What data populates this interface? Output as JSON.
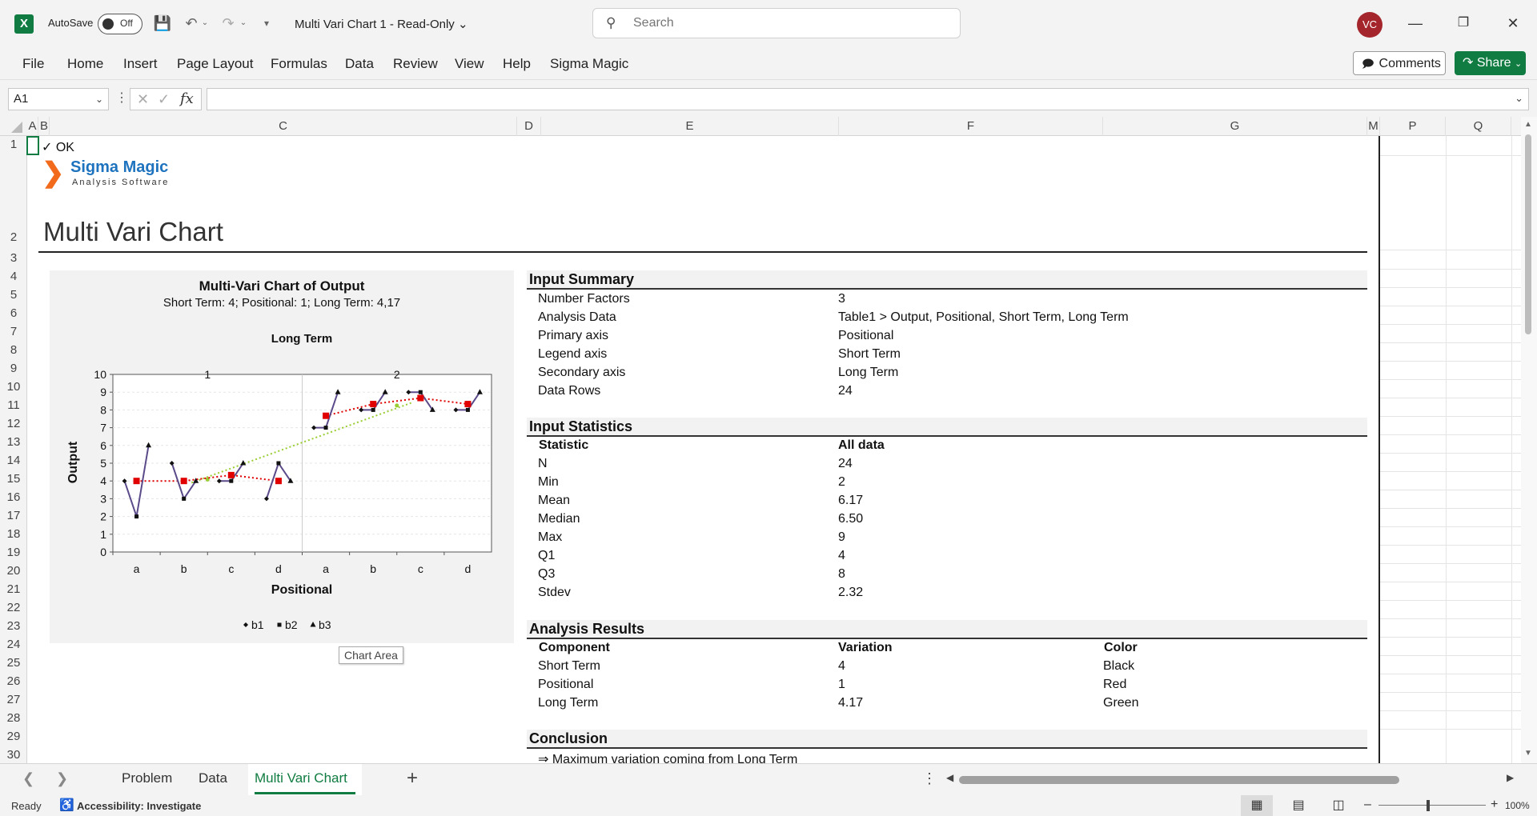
{
  "titlebar": {
    "app_icon": "X",
    "autosave_label": "AutoSave",
    "autosave_state": "Off",
    "doc_title": "Multi Vari Chart 1  -  Read-Only",
    "search_placeholder": "Search",
    "avatar_initials": "VC"
  },
  "ribbon": {
    "tabs": [
      "File",
      "Home",
      "Insert",
      "Page Layout",
      "Formulas",
      "Data",
      "Review",
      "View",
      "Help",
      "Sigma Magic"
    ],
    "comments_label": "Comments",
    "share_label": "Share"
  },
  "formula_bar": {
    "name_box": "A1",
    "formula": ""
  },
  "columns": [
    "A",
    "B",
    "C",
    "D",
    "E",
    "F",
    "G",
    "M",
    "P",
    "Q"
  ],
  "rows": [
    "1",
    "2",
    "3",
    "4",
    "5",
    "6",
    "7",
    "8",
    "9",
    "10",
    "11",
    "12",
    "13",
    "14",
    "15",
    "16",
    "17",
    "18",
    "19",
    "20",
    "21",
    "22",
    "23",
    "24",
    "25",
    "26",
    "27",
    "28",
    "29",
    "30"
  ],
  "sheet": {
    "ok_text": "✓ OK",
    "logo_name": "Sigma Magic",
    "logo_sub": "Analysis Software",
    "page_title": "Multi Vari Chart",
    "chart_tooltip": "Chart Area"
  },
  "chart_data": {
    "type": "line",
    "title": "Multi-Vari Chart of Output",
    "subtitle": "Short Term: 4; Positional: 1; Long Term: 4,17",
    "panel_title": "Long Term",
    "panels": [
      "1",
      "2"
    ],
    "xlabel": "Positional",
    "ylabel": "Output",
    "ylim": [
      0,
      10
    ],
    "yticks": [
      0,
      1,
      2,
      3,
      4,
      5,
      6,
      7,
      8,
      9,
      10
    ],
    "categories": [
      "a",
      "b",
      "c",
      "d",
      "a",
      "b",
      "c",
      "d"
    ],
    "series": [
      {
        "name": "b1",
        "values": [
          4,
          5,
          4,
          3,
          7,
          8,
          9,
          8
        ]
      },
      {
        "name": "b2",
        "values": [
          2,
          3,
          4,
          5,
          7,
          8,
          9,
          8
        ]
      },
      {
        "name": "b3",
        "values": [
          6,
          4,
          5,
          4,
          9,
          9,
          8,
          9
        ]
      }
    ],
    "positional_means": [
      4,
      4,
      4.33,
      4,
      7.67,
      8.33,
      8.67,
      8.33
    ],
    "long_term_means": [
      4.08,
      8.25
    ],
    "colors": {
      "short_term": "#5b4a8a",
      "positional": "#e00000",
      "long_term": "#9acd32"
    },
    "legend_position": "bottom",
    "grid": true
  },
  "input_summary": {
    "header": "Input Summary",
    "rows": [
      [
        "Number Factors",
        "3"
      ],
      [
        "Analysis Data",
        "Table1 > Output, Positional, Short Term, Long Term"
      ],
      [
        "Primary axis",
        "Positional"
      ],
      [
        "Legend axis",
        "Short Term"
      ],
      [
        "Secondary axis",
        "Long Term"
      ],
      [
        "Data Rows",
        "24"
      ]
    ]
  },
  "input_statistics": {
    "header": "Input Statistics",
    "columns": [
      "Statistic",
      "All data"
    ],
    "rows": [
      [
        "N",
        "24"
      ],
      [
        "Min",
        "2"
      ],
      [
        "Mean",
        "6.17"
      ],
      [
        "Median",
        "6.50"
      ],
      [
        "Max",
        "9"
      ],
      [
        "Q1",
        "4"
      ],
      [
        "Q3",
        "8"
      ],
      [
        "Stdev",
        "2.32"
      ]
    ]
  },
  "analysis_results": {
    "header": "Analysis Results",
    "columns": [
      "Component",
      "Variation",
      "Color"
    ],
    "rows": [
      [
        "Short Term",
        "4",
        "Black"
      ],
      [
        "Positional",
        "1",
        "Red"
      ],
      [
        "Long Term",
        "4.17",
        "Green"
      ]
    ]
  },
  "conclusion": {
    "header": "Conclusion",
    "text": "⇒ Maximum variation coming from Long Term"
  },
  "tabs": {
    "sheets": [
      "Problem",
      "Data",
      "Multi Vari Chart"
    ],
    "active": "Multi Vari Chart"
  },
  "statusbar": {
    "ready": "Ready",
    "accessibility": "Accessibility: Investigate",
    "zoom": "100%"
  }
}
